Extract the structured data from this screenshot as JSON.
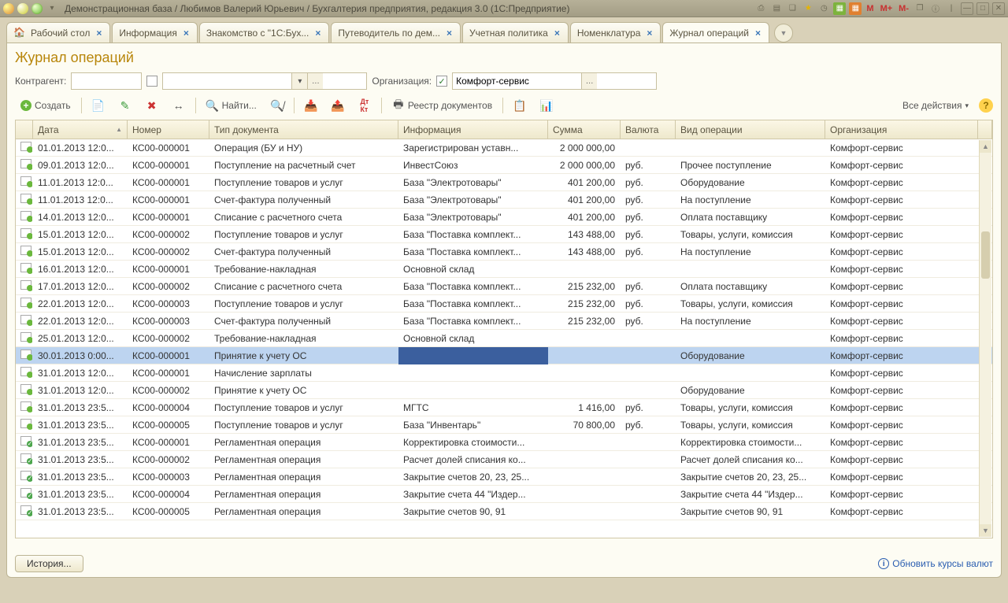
{
  "window_title": "Демонстрационная база / Любимов Валерий Юрьевич / Бухгалтерия предприятия, редакция 3.0  (1С:Предприятие)",
  "tabs": [
    {
      "label": "Рабочий стол"
    },
    {
      "label": "Информация"
    },
    {
      "label": "Знакомство с \"1С:Бух..."
    },
    {
      "label": "Путеводитель по дем..."
    },
    {
      "label": "Учетная политика"
    },
    {
      "label": "Номенклатура"
    },
    {
      "label": "Журнал операций"
    }
  ],
  "page_title": "Журнал операций",
  "filters": {
    "counterparty_label": "Контрагент:",
    "counterparty_value": "",
    "checkbox1": false,
    "combo2_value": "",
    "org_label": "Организация:",
    "org_checked": true,
    "org_value": "Комфорт-сервис"
  },
  "toolbar": {
    "create": "Создать",
    "find": "Найти...",
    "registry": "Реестр документов",
    "all_actions": "Все действия"
  },
  "columns": {
    "date": "Дата",
    "number": "Номер",
    "doctype": "Тип документа",
    "info": "Информация",
    "sum": "Сумма",
    "currency": "Валюта",
    "optype": "Вид операции",
    "org": "Организация"
  },
  "rows": [
    {
      "icon": "posted",
      "date": "01.01.2013 12:0...",
      "num": "КС00-000001",
      "type": "Операция (БУ и НУ)",
      "info": "Зарегистрирован уставн...",
      "sum": "2 000 000,00",
      "cur": "",
      "op": "",
      "org": "Комфорт-сервис"
    },
    {
      "icon": "posted",
      "date": "09.01.2013 12:0...",
      "num": "КС00-000001",
      "type": "Поступление на расчетный счет",
      "info": "ИнвестСоюз",
      "sum": "2 000 000,00",
      "cur": "руб.",
      "op": "Прочее поступление",
      "org": "Комфорт-сервис"
    },
    {
      "icon": "posted",
      "date": "11.01.2013 12:0...",
      "num": "КС00-000001",
      "type": "Поступление товаров и услуг",
      "info": "База \"Электротовары\"",
      "sum": "401 200,00",
      "cur": "руб.",
      "op": "Оборудование",
      "org": "Комфорт-сервис"
    },
    {
      "icon": "posted",
      "date": "11.01.2013 12:0...",
      "num": "КС00-000001",
      "type": "Счет-фактура полученный",
      "info": "База \"Электротовары\"",
      "sum": "401 200,00",
      "cur": "руб.",
      "op": "На поступление",
      "org": "Комфорт-сервис"
    },
    {
      "icon": "posted",
      "date": "14.01.2013 12:0...",
      "num": "КС00-000001",
      "type": "Списание с расчетного счета",
      "info": "База \"Электротовары\"",
      "sum": "401 200,00",
      "cur": "руб.",
      "op": "Оплата поставщику",
      "org": "Комфорт-сервис"
    },
    {
      "icon": "posted",
      "date": "15.01.2013 12:0...",
      "num": "КС00-000002",
      "type": "Поступление товаров и услуг",
      "info": "База \"Поставка комплект...",
      "sum": "143 488,00",
      "cur": "руб.",
      "op": "Товары, услуги, комиссия",
      "org": "Комфорт-сервис"
    },
    {
      "icon": "posted",
      "date": "15.01.2013 12:0...",
      "num": "КС00-000002",
      "type": "Счет-фактура полученный",
      "info": "База \"Поставка комплект...",
      "sum": "143 488,00",
      "cur": "руб.",
      "op": "На поступление",
      "org": "Комфорт-сервис"
    },
    {
      "icon": "posted",
      "date": "16.01.2013 12:0...",
      "num": "КС00-000001",
      "type": "Требование-накладная",
      "info": "Основной склад",
      "sum": "",
      "cur": "",
      "op": "",
      "org": "Комфорт-сервис"
    },
    {
      "icon": "posted",
      "date": "17.01.2013 12:0...",
      "num": "КС00-000002",
      "type": "Списание с расчетного счета",
      "info": "База \"Поставка комплект...",
      "sum": "215 232,00",
      "cur": "руб.",
      "op": "Оплата поставщику",
      "org": "Комфорт-сервис"
    },
    {
      "icon": "posted",
      "date": "22.01.2013 12:0...",
      "num": "КС00-000003",
      "type": "Поступление товаров и услуг",
      "info": "База \"Поставка комплект...",
      "sum": "215 232,00",
      "cur": "руб.",
      "op": "Товары, услуги, комиссия",
      "org": "Комфорт-сервис"
    },
    {
      "icon": "posted",
      "date": "22.01.2013 12:0...",
      "num": "КС00-000003",
      "type": "Счет-фактура полученный",
      "info": "База \"Поставка комплект...",
      "sum": "215 232,00",
      "cur": "руб.",
      "op": "На поступление",
      "org": "Комфорт-сервис"
    },
    {
      "icon": "posted",
      "date": "25.01.2013 12:0...",
      "num": "КС00-000002",
      "type": "Требование-накладная",
      "info": "Основной склад",
      "sum": "",
      "cur": "",
      "op": "",
      "org": "Комфорт-сервис"
    },
    {
      "icon": "posted",
      "date": "30.01.2013 0:00...",
      "num": "КС00-000001",
      "type": "Принятие к учету ОС",
      "info": "",
      "sum": "",
      "cur": "",
      "op": "Оборудование",
      "org": "Комфорт-сервис",
      "selected": true
    },
    {
      "icon": "posted",
      "date": "31.01.2013 12:0...",
      "num": "КС00-000001",
      "type": "Начисление зарплаты",
      "info": "",
      "sum": "",
      "cur": "",
      "op": "",
      "org": "Комфорт-сервис"
    },
    {
      "icon": "posted",
      "date": "31.01.2013 12:0...",
      "num": "КС00-000002",
      "type": "Принятие к учету ОС",
      "info": "",
      "sum": "",
      "cur": "",
      "op": "Оборудование",
      "org": "Комфорт-сервис"
    },
    {
      "icon": "posted",
      "date": "31.01.2013 23:5...",
      "num": "КС00-000004",
      "type": "Поступление товаров и услуг",
      "info": "МГТС",
      "sum": "1 416,00",
      "cur": "руб.",
      "op": "Товары, услуги, комиссия",
      "org": "Комфорт-сервис"
    },
    {
      "icon": "posted",
      "date": "31.01.2013 23:5...",
      "num": "КС00-000005",
      "type": "Поступление товаров и услуг",
      "info": "База \"Инвентарь\"",
      "sum": "70 800,00",
      "cur": "руб.",
      "op": "Товары, услуги, комиссия",
      "org": "Комфорт-сервис"
    },
    {
      "icon": "check",
      "date": "31.01.2013 23:5...",
      "num": "КС00-000001",
      "type": "Регламентная операция",
      "info": "Корректировка стоимости...",
      "sum": "",
      "cur": "",
      "op": "Корректировка стоимости...",
      "org": "Комфорт-сервис"
    },
    {
      "icon": "check",
      "date": "31.01.2013 23:5...",
      "num": "КС00-000002",
      "type": "Регламентная операция",
      "info": "Расчет долей списания ко...",
      "sum": "",
      "cur": "",
      "op": "Расчет долей списания ко...",
      "org": "Комфорт-сервис"
    },
    {
      "icon": "check",
      "date": "31.01.2013 23:5...",
      "num": "КС00-000003",
      "type": "Регламентная операция",
      "info": "Закрытие счетов 20, 23, 25...",
      "sum": "",
      "cur": "",
      "op": "Закрытие счетов 20, 23, 25...",
      "org": "Комфорт-сервис"
    },
    {
      "icon": "check",
      "date": "31.01.2013 23:5...",
      "num": "КС00-000004",
      "type": "Регламентная операция",
      "info": "Закрытие счета 44 \"Издер...",
      "sum": "",
      "cur": "",
      "op": "Закрытие счета 44 \"Издер...",
      "org": "Комфорт-сервис"
    },
    {
      "icon": "check",
      "date": "31.01.2013 23:5...",
      "num": "КС00-000005",
      "type": "Регламентная операция",
      "info": "Закрытие счетов 90, 91",
      "sum": "",
      "cur": "",
      "op": "Закрытие счетов 90, 91",
      "org": "Комфорт-сервис"
    }
  ],
  "statusbar": {
    "history": "История...",
    "update_link": "Обновить курсы валют"
  }
}
